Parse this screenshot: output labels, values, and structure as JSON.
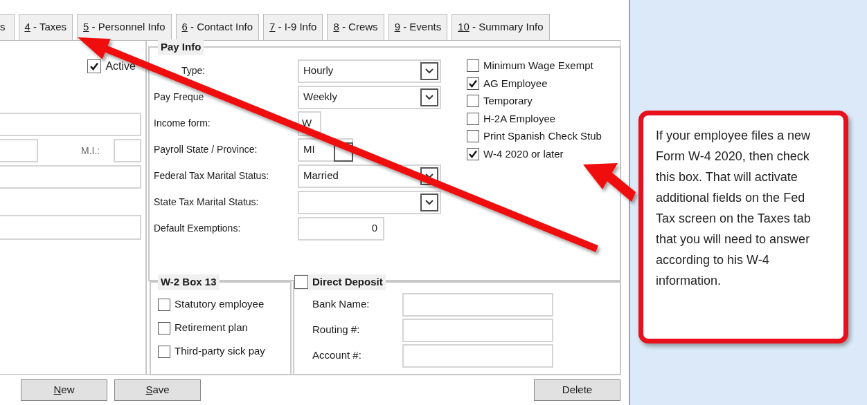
{
  "tabs": [
    {
      "rest": "s"
    },
    {
      "mnemonic": "4",
      "rest": " - Taxes"
    },
    {
      "mnemonic": "5",
      "rest": " - Personnel Info"
    },
    {
      "mnemonic": "6",
      "rest": " - Contact Info"
    },
    {
      "mnemonic": "7",
      "rest": " - I-9 Info"
    },
    {
      "mnemonic": "8",
      "rest": " - Crews"
    },
    {
      "mnemonic": "9",
      "rest": " - Events"
    },
    {
      "mnemonic": "10",
      "rest": " - Summary Info"
    }
  ],
  "employee": {
    "active": {
      "label": "Active",
      "checked": true
    },
    "mi_label": "M.I.:"
  },
  "pay_info": {
    "title": "Pay Info",
    "fields": [
      {
        "kind": "select",
        "label": "Type:",
        "covered": true,
        "value": "Hourly"
      },
      {
        "kind": "select",
        "label": "Pay Freque",
        "covered": false,
        "value": "Weekly"
      },
      {
        "kind": "short",
        "label": "Income form:",
        "value": "W"
      },
      {
        "kind": "lookup",
        "label": "Payroll State / Province:",
        "value": "MI"
      },
      {
        "kind": "select",
        "label": "Federal Tax Marital Status:",
        "value": "Married"
      },
      {
        "kind": "select",
        "label": "State Tax Marital Status:"
      },
      {
        "kind": "number",
        "label": "Default Exemptions:",
        "value": "0"
      }
    ],
    "options": [
      {
        "label": "Minimum Wage Exempt",
        "checked": false
      },
      {
        "label": "AG Employee",
        "checked": true
      },
      {
        "label": "Temporary",
        "checked": false
      },
      {
        "label": "H-2A Employee",
        "checked": false
      },
      {
        "label": "Print Spanish Check Stub",
        "checked": false
      },
      {
        "label": "W-4 2020 or later",
        "checked": true
      }
    ]
  },
  "w2_box13": {
    "title": "W-2 Box 13",
    "options": [
      {
        "label": "Statutory employee",
        "checked": false
      },
      {
        "label": "Retirement plan",
        "checked": false
      },
      {
        "label": "Third-party sick pay",
        "checked": false
      }
    ]
  },
  "direct_deposit": {
    "title": "Direct Deposit",
    "checked": false,
    "fields": [
      {
        "label": "Bank Name:"
      },
      {
        "label": "Routing #:"
      },
      {
        "label": "Account #:"
      }
    ]
  },
  "buttons_left": [
    {
      "mnemonic": "N",
      "rest": "ew"
    },
    {
      "mnemonic": "S",
      "rest": "ave"
    }
  ],
  "buttons_right": [
    {
      "rest": "Delete"
    }
  ],
  "callout": {
    "text": "If your employee files a new Form W-4 2020, then check this box. That will activate additional fields on the Fed Tax screen on the Taxes tab that you will need to answer according to his W-4 information."
  }
}
